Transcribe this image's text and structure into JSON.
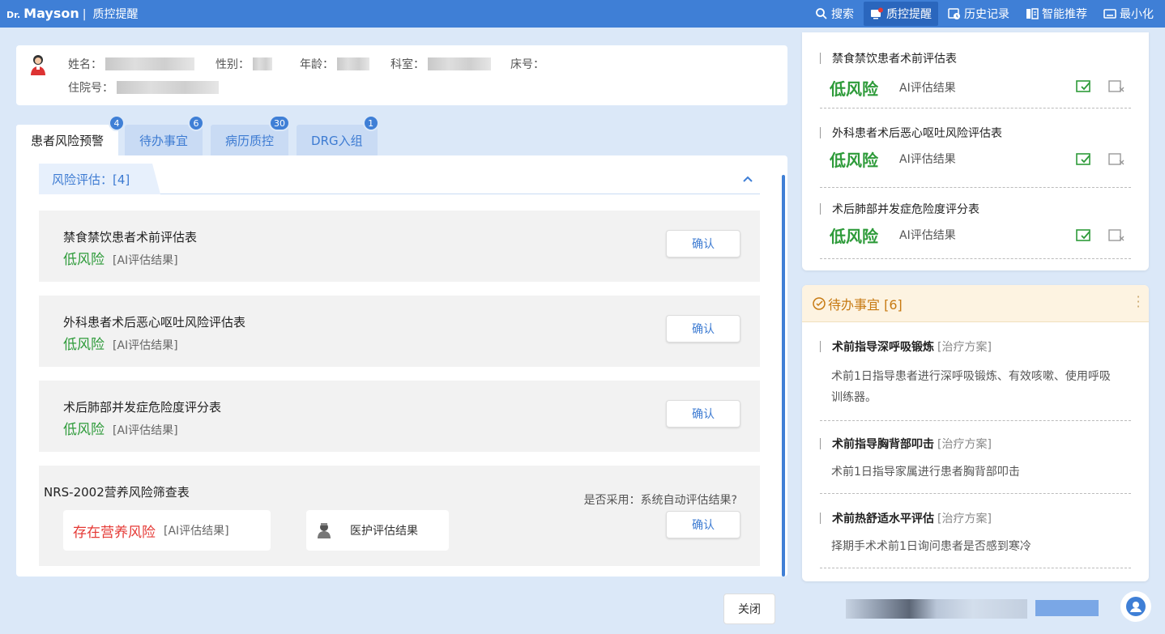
{
  "topbar": {
    "brand_prefix": "Dr.",
    "brand_name": "Mayson",
    "brand_sep": "|",
    "brand_title": "质控提醒",
    "nav": [
      {
        "label": "搜索",
        "icon": "search-icon"
      },
      {
        "label": "质控提醒",
        "icon": "alert-monitor-icon",
        "active": true
      },
      {
        "label": "历史记录",
        "icon": "history-icon"
      },
      {
        "label": "智能推荐",
        "icon": "recommend-icon"
      },
      {
        "label": "最小化",
        "icon": "minimize-icon"
      }
    ]
  },
  "patient": {
    "name_label": "姓名：",
    "gender_label": "性别：",
    "age_label": "年龄：",
    "dept_label": "科室：",
    "bed_label": "床号：",
    "admission_label": "住院号："
  },
  "tabs": [
    {
      "label": "患者风险预警",
      "badge": "4",
      "active": true
    },
    {
      "label": "待办事宜",
      "badge": "6"
    },
    {
      "label": "病历质控",
      "badge": "30"
    },
    {
      "label": "DRG入组",
      "badge": "1"
    }
  ],
  "section": {
    "label": "风险评估：[4]"
  },
  "assessments": [
    {
      "title": "禁食禁饮患者术前评估表",
      "risk": "低风险",
      "result": "[AI评估结果]",
      "button": "确认"
    },
    {
      "title": "外科患者术后恶心呕吐风险评估表",
      "risk": "低风险",
      "result": "[AI评估结果]",
      "button": "确认"
    },
    {
      "title": "术后肺部并发症危险度评分表",
      "risk": "低风险",
      "result": "[AI评估结果]",
      "button": "确认"
    }
  ],
  "nrs": {
    "title": "NRS-2002营养风险筛查表",
    "question": "是否采用：系统自动评估结果?",
    "risk": "存在营养风险",
    "result": "[AI评估结果]",
    "nurse_label": "医护评估结果",
    "button": "确认"
  },
  "footer": {
    "close": "关闭"
  },
  "right_risk": [
    {
      "title": "禁食禁饮患者术前评估表",
      "risk": "低风险",
      "result": "AI评估结果"
    },
    {
      "title": "外科患者术后恶心呕吐风险评估表",
      "risk": "低风险",
      "result": "AI评估结果"
    },
    {
      "title": "术后肺部并发症危险度评分表",
      "risk": "低风险",
      "result": "AI评估结果"
    }
  ],
  "todo": {
    "header": "待办事宜 [6]",
    "items": [
      {
        "title": "术前指导深呼吸锻炼",
        "tag": "[治疗方案]",
        "desc": "术前1日指导患者进行深呼吸锻炼、有效咳嗽、使用呼吸训练器。"
      },
      {
        "title": "术前指导胸背部叩击",
        "tag": "[治疗方案]",
        "desc": "术前1日指导家属进行患者胸背部叩击"
      },
      {
        "title": "术前热舒适水平评估",
        "tag": "[治疗方案]",
        "desc": "择期手术术前1日询问患者是否感到寒冷"
      }
    ]
  },
  "colors": {
    "accent": "#3f7fd6",
    "low_risk": "#2e9b3a",
    "high_risk": "#e53935",
    "todo_header": "#c77a12"
  }
}
